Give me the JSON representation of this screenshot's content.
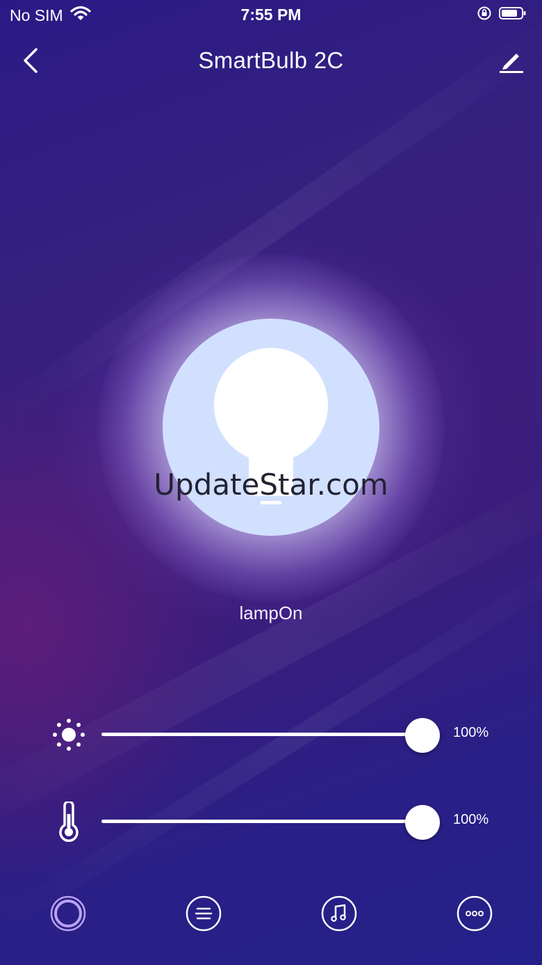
{
  "status_bar": {
    "carrier": "No SIM",
    "time": "7:55 PM",
    "icons": [
      "wifi-icon",
      "orientation-lock-icon",
      "battery-icon"
    ]
  },
  "header": {
    "title": "SmartBulb 2C",
    "back_icon": "chevron-left-icon",
    "edit_icon": "pencil-icon"
  },
  "lamp": {
    "status": "lampOn",
    "icon": "lightbulb-icon",
    "color": "#d2e0ff"
  },
  "watermark": "UpdateStar.com",
  "sliders": [
    {
      "name": "brightness",
      "icon": "sun-icon",
      "value": 100,
      "label": "100%"
    },
    {
      "name": "color-temperature",
      "icon": "thermometer-icon",
      "value": 100,
      "label": "100%"
    }
  ],
  "bottom_nav": {
    "items": [
      {
        "name": "color",
        "icon": "circle-ring-icon",
        "active": true
      },
      {
        "name": "scenes",
        "icon": "list-icon",
        "active": false
      },
      {
        "name": "music",
        "icon": "music-note-icon",
        "active": false
      },
      {
        "name": "more",
        "icon": "more-dots-icon",
        "active": false
      }
    ],
    "active_color": "#b9a3f2"
  }
}
